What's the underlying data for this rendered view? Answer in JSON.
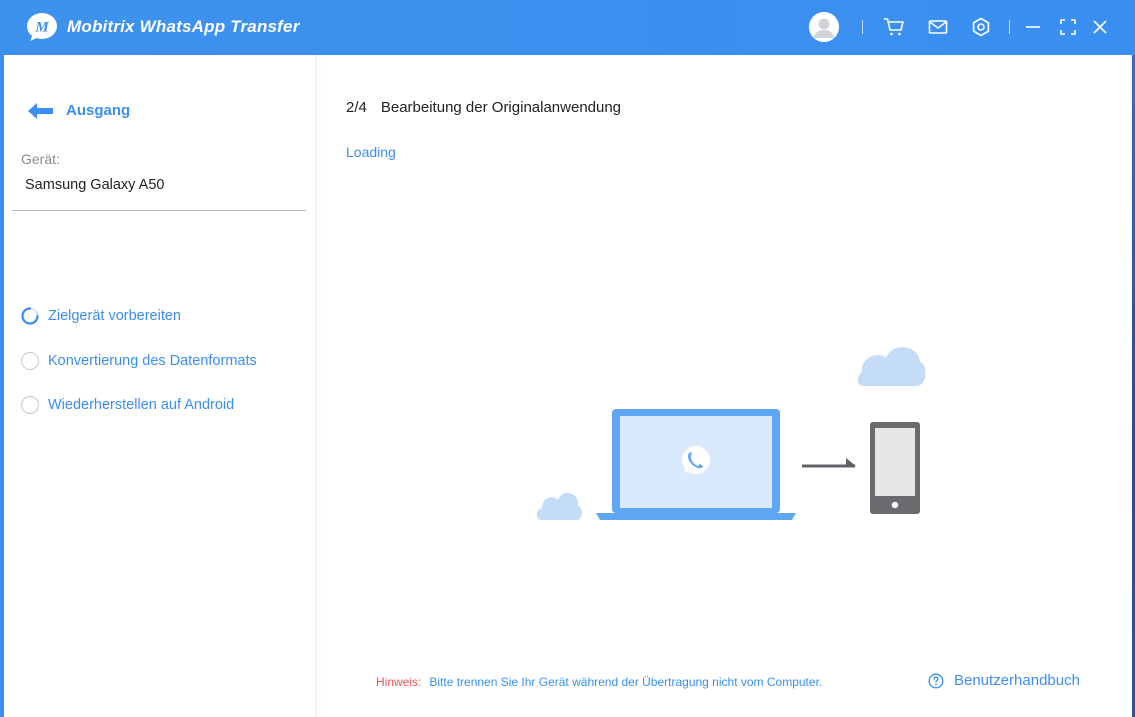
{
  "titlebar": {
    "app_title": "Mobitrix WhatsApp Transfer",
    "logo_letter": "M",
    "icons": [
      "user-avatar-icon",
      "cart-icon",
      "mail-icon",
      "settings-icon",
      "minimize-icon",
      "maximize-icon",
      "close-icon"
    ]
  },
  "sidebar": {
    "back_label": "Ausgang",
    "device_label": "Gerät:",
    "device_name": "Samsung Galaxy A50",
    "steps": [
      {
        "label": "Zielgerät vorbereiten",
        "state": "in-progress"
      },
      {
        "label": "Konvertierung des Datenformats",
        "state": "pending"
      },
      {
        "label": "Wiederherstellen auf Android",
        "state": "pending"
      }
    ]
  },
  "main": {
    "step_number": "2/4",
    "step_title": "Bearbeitung der Originalanwendung",
    "status": "Loading",
    "footer_hint_label": "Hinweis:",
    "footer_hint_text": "Bitte trennen Sie Ihr Gerät während der Übertragung nicht vom Computer.",
    "manual_label": "Benutzerhandbuch"
  },
  "colors": {
    "accent": "#3a8ff0",
    "hint": "#e25757",
    "text": "#222222",
    "muted": "#8c8c8c"
  }
}
